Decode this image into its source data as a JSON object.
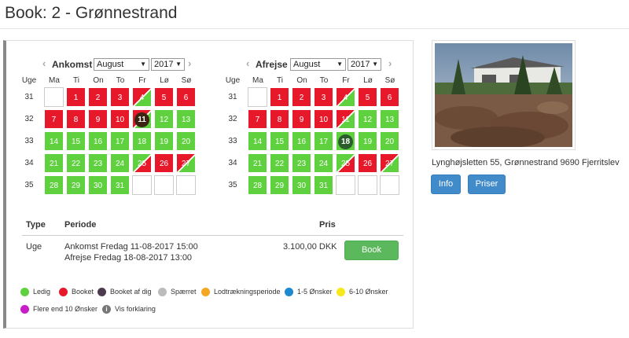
{
  "page": {
    "title": "Book: 2 - Grønnestrand"
  },
  "colors": {
    "ledig": "#5fd13f",
    "booket": "#e8182b",
    "booket_af_dig": "#4d3b4d",
    "spaerret": "#bbbbbb",
    "lodtraekning": "#f5a623",
    "onsker_1_5": "#1e88d0",
    "onsker_6_10": "#f7e81b",
    "onsker_10": "#c81ec8",
    "book_button": "#5cb85c",
    "info_button": "#428bca"
  },
  "calendars": [
    {
      "label": "Ankomst",
      "month": "August",
      "year": "2017",
      "week_header": "Uge",
      "days": [
        "Ma",
        "Ti",
        "On",
        "To",
        "Fr",
        "Lø",
        "Sø"
      ],
      "weeks": [
        {
          "num": "31",
          "cells": [
            {
              "t": "",
              "s": "e"
            },
            {
              "t": "1",
              "s": "r"
            },
            {
              "t": "2",
              "s": "r"
            },
            {
              "t": "3",
              "s": "r"
            },
            {
              "t": "4",
              "s": "rg"
            },
            {
              "t": "5",
              "s": "r"
            },
            {
              "t": "6",
              "s": "r"
            }
          ]
        },
        {
          "num": "32",
          "cells": [
            {
              "t": "7",
              "s": "r"
            },
            {
              "t": "8",
              "s": "r"
            },
            {
              "t": "9",
              "s": "r"
            },
            {
              "t": "10",
              "s": "r"
            },
            {
              "t": "11",
              "s": "rg",
              "sel": "dark"
            },
            {
              "t": "12",
              "s": "g"
            },
            {
              "t": "13",
              "s": "g"
            }
          ]
        },
        {
          "num": "33",
          "cells": [
            {
              "t": "14",
              "s": "g"
            },
            {
              "t": "15",
              "s": "g"
            },
            {
              "t": "16",
              "s": "g"
            },
            {
              "t": "17",
              "s": "g"
            },
            {
              "t": "18",
              "s": "g"
            },
            {
              "t": "19",
              "s": "g"
            },
            {
              "t": "20",
              "s": "g"
            }
          ]
        },
        {
          "num": "34",
          "cells": [
            {
              "t": "21",
              "s": "g"
            },
            {
              "t": "22",
              "s": "g"
            },
            {
              "t": "23",
              "s": "g"
            },
            {
              "t": "24",
              "s": "g"
            },
            {
              "t": "25",
              "s": "gr"
            },
            {
              "t": "26",
              "s": "r"
            },
            {
              "t": "27",
              "s": "rg"
            }
          ]
        },
        {
          "num": "35",
          "cells": [
            {
              "t": "28",
              "s": "g"
            },
            {
              "t": "29",
              "s": "g"
            },
            {
              "t": "30",
              "s": "g"
            },
            {
              "t": "31",
              "s": "g"
            },
            {
              "t": "",
              "s": "e"
            },
            {
              "t": "",
              "s": "e"
            },
            {
              "t": "",
              "s": "e"
            }
          ]
        }
      ]
    },
    {
      "label": "Afrejse",
      "month": "August",
      "year": "2017",
      "week_header": "Uge",
      "days": [
        "Ma",
        "Ti",
        "On",
        "To",
        "Fr",
        "Lø",
        "Sø"
      ],
      "weeks": [
        {
          "num": "31",
          "cells": [
            {
              "t": "",
              "s": "e"
            },
            {
              "t": "1",
              "s": "r"
            },
            {
              "t": "2",
              "s": "r"
            },
            {
              "t": "3",
              "s": "r"
            },
            {
              "t": "4",
              "s": "rg"
            },
            {
              "t": "5",
              "s": "r"
            },
            {
              "t": "6",
              "s": "r"
            }
          ]
        },
        {
          "num": "32",
          "cells": [
            {
              "t": "7",
              "s": "r"
            },
            {
              "t": "8",
              "s": "r"
            },
            {
              "t": "9",
              "s": "r"
            },
            {
              "t": "10",
              "s": "r"
            },
            {
              "t": "11",
              "s": "rg"
            },
            {
              "t": "12",
              "s": "g"
            },
            {
              "t": "13",
              "s": "g"
            }
          ]
        },
        {
          "num": "33",
          "cells": [
            {
              "t": "14",
              "s": "g"
            },
            {
              "t": "15",
              "s": "g"
            },
            {
              "t": "16",
              "s": "g"
            },
            {
              "t": "17",
              "s": "g"
            },
            {
              "t": "18",
              "s": "g",
              "sel": "green"
            },
            {
              "t": "19",
              "s": "g"
            },
            {
              "t": "20",
              "s": "g"
            }
          ]
        },
        {
          "num": "34",
          "cells": [
            {
              "t": "21",
              "s": "g"
            },
            {
              "t": "22",
              "s": "g"
            },
            {
              "t": "23",
              "s": "g"
            },
            {
              "t": "24",
              "s": "g"
            },
            {
              "t": "25",
              "s": "gr"
            },
            {
              "t": "26",
              "s": "r"
            },
            {
              "t": "27",
              "s": "rg"
            }
          ]
        },
        {
          "num": "35",
          "cells": [
            {
              "t": "28",
              "s": "g"
            },
            {
              "t": "29",
              "s": "g"
            },
            {
              "t": "30",
              "s": "g"
            },
            {
              "t": "31",
              "s": "g"
            },
            {
              "t": "",
              "s": "e"
            },
            {
              "t": "",
              "s": "e"
            },
            {
              "t": "",
              "s": "e"
            }
          ]
        }
      ]
    }
  ],
  "booking": {
    "headers": {
      "type": "Type",
      "periode": "Periode",
      "pris": "Pris"
    },
    "type": "Uge",
    "ankomst": "Ankomst Fredag 11-08-2017 15:00",
    "afrejse": "Afrejse Fredag 18-08-2017 13:00",
    "price": "3.100,00 DKK",
    "book_label": "Book"
  },
  "legend": {
    "ledig": "Ledig",
    "booket": "Booket",
    "booket_af_dig": "Booket af dig",
    "spaerret": "Spærret",
    "lodtraekning": "Lodtrækningsperiode",
    "onsker_1_5": "1-5 Ønsker",
    "onsker_6_10": "6-10 Ønsker",
    "onsker_10": "Flere end 10 Ønsker",
    "vis_forklaring": "Vis forklaring"
  },
  "property": {
    "address": "Lynghøjsletten 55, Grønnestrand 9690 Fjerritslev",
    "info_label": "Info",
    "priser_label": "Priser"
  }
}
